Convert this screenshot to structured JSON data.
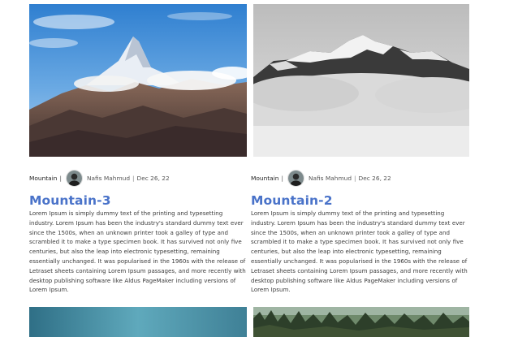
{
  "posts": [
    {
      "image_alt": "Snow-capped mountain peak above clouds under blue sky",
      "category": "Mountain",
      "author": "Nafis Mahmud",
      "date": "Dec 26, 22",
      "title": "Mountain-3",
      "excerpt": "Lorem Ipsum is simply dummy text of the printing and typesetting industry. Lorem Ipsum has been the industry's standard dummy text ever since the 1500s, when an unknown printer took a galley of type and scrambled it to make a type specimen book. It has survived not only five centuries, but also the leap into electronic typesetting, remaining essentially unchanged. It was popularised in the 1960s with the release of Letraset sheets containing Lorem Ipsum passages, and more recently with desktop publishing software like Aldus PageMaker including versions of Lorem Ipsum."
    },
    {
      "image_alt": "Black and white mountain range wrapped in mist",
      "category": "Mountain",
      "author": "Nafis Mahmud",
      "date": "Dec 26, 22",
      "title": "Mountain-2",
      "excerpt": "Lorem Ipsum is simply dummy text of the printing and typesetting industry. Lorem Ipsum has been the industry's standard dummy text ever since the 1500s, when an unknown printer took a galley of type and scrambled it to make a type specimen book. It has survived not only five centuries, but also the leap into electronic typesetting, remaining essentially unchanged. It was popularised in the 1960s with the release of Letraset sheets containing Lorem Ipsum passages, and more recently with desktop publishing software like Aldus PageMaker including versions of Lorem Ipsum."
    }
  ],
  "colors": {
    "title": "#4a73c9",
    "text": "#3c3c3c"
  }
}
